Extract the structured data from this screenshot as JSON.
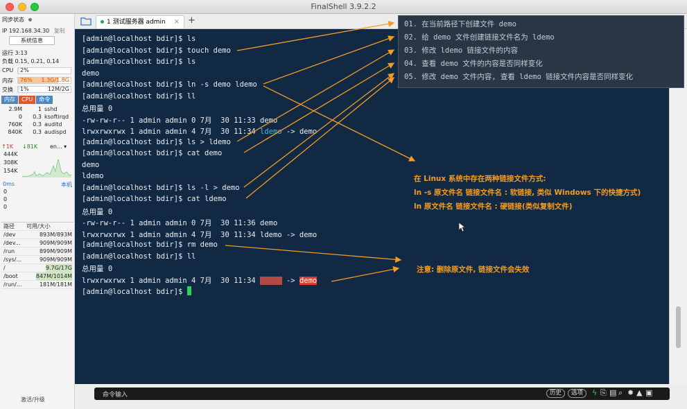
{
  "app": {
    "title": "FinalShell 3.9.2.2"
  },
  "sidebar": {
    "sync_status": "同步状态",
    "ip": "IP 192.168.34.30",
    "copy": "复制",
    "sysinfo_button": "系统信息",
    "uptime": "运行 3:13",
    "load": "负载 0.15, 0.21, 0.14",
    "cpu": {
      "label": "CPU",
      "percent": "2%",
      "fraction": 0.02
    },
    "memory": {
      "label": "内存",
      "percent": "76%",
      "value": "1.3G/1.8G",
      "fraction": 0.76
    },
    "swap": {
      "label": "交换",
      "percent": "1%",
      "value": "12M/2G",
      "fraction": 0.01
    },
    "proc_tabs": [
      "内存",
      "CPU",
      "命令"
    ],
    "processes": [
      {
        "mem": "2.9M",
        "cpu": "1",
        "cmd": "sshd"
      },
      {
        "mem": "0",
        "cpu": "0.3",
        "cmd": "ksoftirqd"
      },
      {
        "mem": "760K",
        "cpu": "0.3",
        "cmd": "auditd"
      },
      {
        "mem": "840K",
        "cpu": "0.3",
        "cmd": "audispd"
      }
    ],
    "network": {
      "up": "↑1K",
      "down": "↓81K",
      "iface": "en... ▾",
      "scale": [
        "444K",
        "308K",
        "154K"
      ]
    },
    "ping": {
      "label": "0ms",
      "host": "本机",
      "values": [
        "0",
        "0",
        "0"
      ]
    },
    "disks": {
      "headers": [
        "路径",
        "可用/大小"
      ],
      "rows": [
        {
          "path": "/dev",
          "size": "893M/893M"
        },
        {
          "path": "/dev...",
          "size": "909M/909M"
        },
        {
          "path": "/run",
          "size": "899M/909M"
        },
        {
          "path": "/sys/...",
          "size": "909M/909M"
        },
        {
          "path": "/",
          "size": "9.7G/17G"
        },
        {
          "path": "/boot",
          "size": "847M/1014M"
        },
        {
          "path": "/run/...",
          "size": "181M/181M"
        }
      ]
    },
    "activate": "激活/升级"
  },
  "tabs": {
    "session_label": "1 测试服务器 admin",
    "close": "×",
    "add": "+"
  },
  "terminal": {
    "lines": [
      "[admin@localhost bdir]$ ls",
      "[admin@localhost bdir]$ touch demo",
      "[admin@localhost bdir]$ ls",
      "demo",
      "[admin@localhost bdir]$ ln -s demo ldemo",
      "[admin@localhost bdir]$ ll",
      "总用量 0",
      "-rw-rw-r-- 1 admin admin 0 7月  30 11:33 demo",
      [
        "lrwxrwxrwx 1 admin admin 4 7月  30 11:34 ",
        "ldemo",
        " -> demo"
      ],
      "[admin@localhost bdir]$ ls > ldemo",
      "[admin@localhost bdir]$ cat demo",
      "demo",
      "ldemo",
      "[admin@localhost bdir]$ ls -l > demo",
      "[admin@localhost bdir]$ cat ldemo",
      "总用量 0",
      "-rw-rw-r-- 1 admin admin 0 7月  30 11:36 demo",
      "lrwxrwxrwx 1 admin admin 4 7月  30 11:34 ldemo -> demo",
      "[admin@localhost bdir]$ rm demo",
      "[admin@localhost bdir]$ ll",
      "总用量 0",
      [
        "lrwxrwxrwx 1 admin admin 4 7月  30 11:34 ",
        "ldemo",
        " -> ",
        "demo"
      ],
      [
        "[admin@localhost bdir]$ ",
        ""
      ]
    ]
  },
  "cmdbar": {
    "label": "命令输入",
    "history": "历史",
    "options": "选项"
  },
  "annotations": {
    "steps": [
      "01. 在当前路径下创建文件 demo",
      "02. 给 demo 文件创建链接文件名为 ldemo",
      "03. 修改 ldemo 链接文件的内容",
      "04. 查看 demo 文件的内容是否同样变化",
      "05. 修改 demo 文件内容, 查看 ldemo 链接文件内容是否同样变化"
    ],
    "link_notes": [
      "在 Linux 系统中存在两种链接文件方式:",
      "ln -s 原文件名 链接文件名 : 软链接, 类似 Windows 下的快捷方式)",
      "ln 原文件名 链接文件名 : 硬链接(类似复制文件)"
    ],
    "delete_note": "注意: 删除原文件, 链接文件会失效"
  },
  "colors": {
    "terminal_bg": "#122944",
    "annotation": "#f39c23",
    "link_cyan": "#3fc1d1",
    "error_red": "#e23a2f"
  }
}
